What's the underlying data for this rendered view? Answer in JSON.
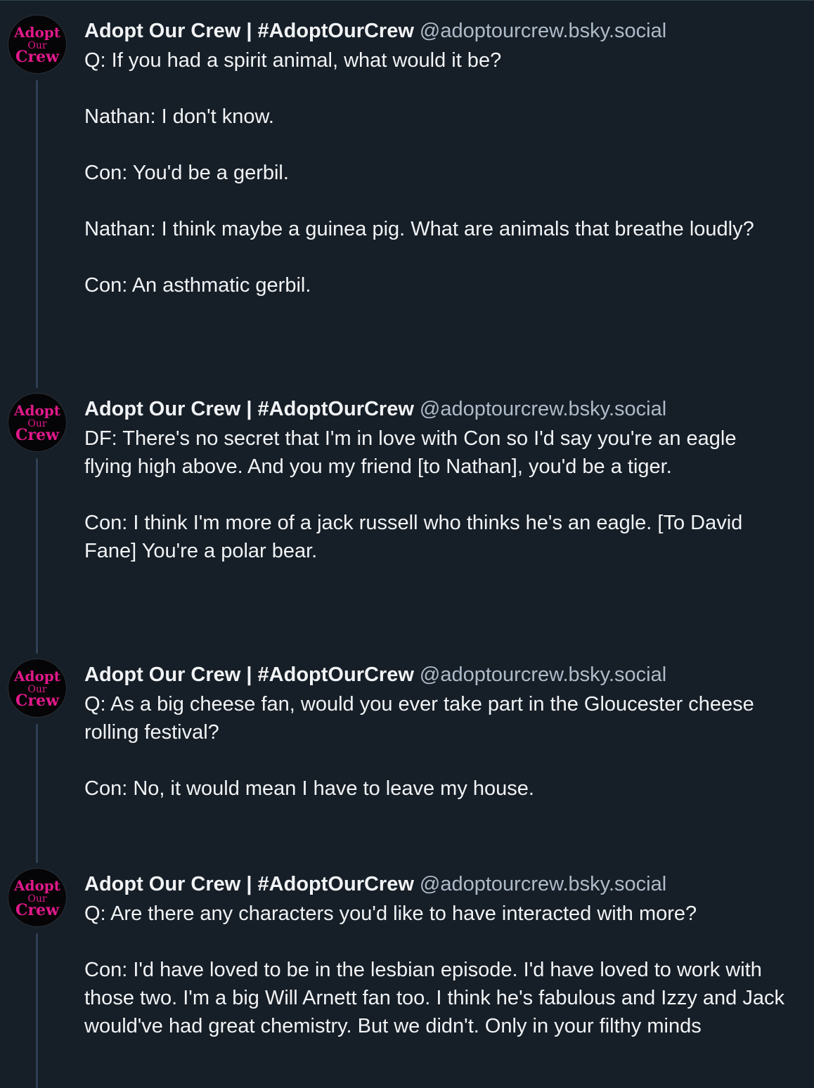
{
  "account": {
    "display_name": "Adopt Our Crew | #AdoptOurCrew",
    "handle": "@adoptourcrew.bsky.social",
    "avatar_text": [
      "Adopt",
      "Our",
      "Crew"
    ],
    "avatar_color": "#e0198a"
  },
  "colors": {
    "background": "#161e27",
    "text": "#f1f3f5",
    "handle": "#aebbc9",
    "thread_line": "#2e4052"
  },
  "posts": [
    {
      "paragraphs": [
        "Q: If you had a spirit animal, what would it be?",
        "Nathan: I don't know.",
        "Con: You'd be a gerbil.",
        "Nathan: I think maybe a guinea pig. What are animals that breathe loudly?",
        "Con: An asthmatic gerbil."
      ]
    },
    {
      "paragraphs": [
        "DF: There's no secret that I'm in love with Con so I'd say you're an eagle flying high above. And you my friend [to Nathan], you'd be a tiger.",
        "Con: I think I'm more of a jack russell who thinks he's an eagle. [To David Fane] You're a polar bear."
      ]
    },
    {
      "paragraphs": [
        "Q: As a big cheese fan, would you ever take part in the Gloucester cheese rolling festival?",
        "Con: No, it would mean I have to leave my house."
      ]
    },
    {
      "paragraphs": [
        "Q: Are there any characters you'd like to have interacted with more?",
        "Con: I'd have loved to be in the lesbian episode. I'd have loved to work with those two. I'm a big Will Arnett fan too. I think he's fabulous and Izzy and Jack would've had great chemistry. But we didn't. Only in your filthy minds"
      ]
    }
  ]
}
